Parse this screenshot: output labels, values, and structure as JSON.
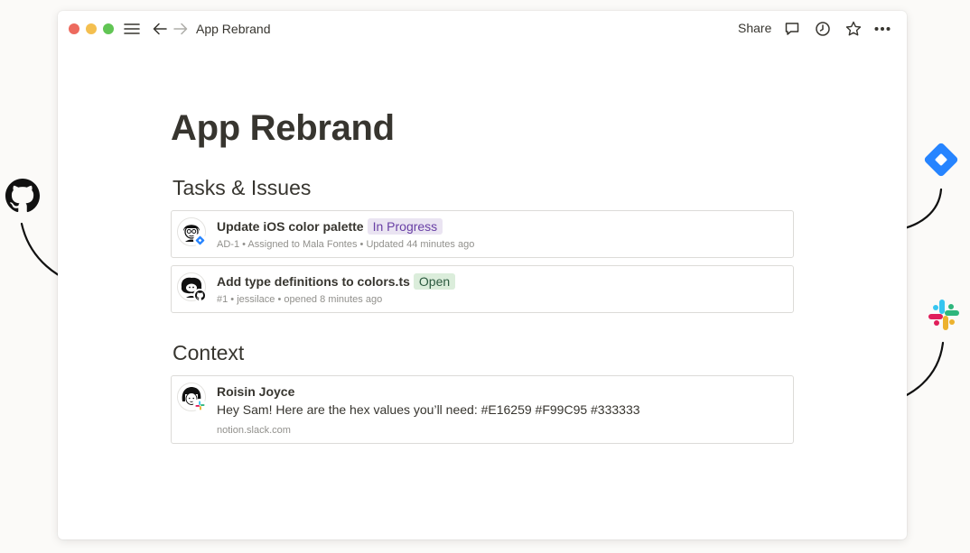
{
  "window": {
    "breadcrumb": "App Rebrand",
    "share_label": "Share",
    "traffic_lights": {
      "close": "#ed6a5e",
      "minimize": "#f4bf4f",
      "zoom": "#61c554"
    },
    "icons": [
      "menu-icon",
      "back-arrow-icon",
      "forward-arrow-icon",
      "comment-icon",
      "clock-history-icon",
      "star-icon",
      "more-icon"
    ]
  },
  "page": {
    "title": "App Rebrand",
    "sections": [
      {
        "heading": "Tasks & Issues",
        "items": [
          {
            "title": "Update iOS color palette",
            "status": "In Progress",
            "meta": "AD-1 • Assigned to Mala Fontes • Updated 44 minutes ago",
            "source_icon": "jira-icon"
          },
          {
            "title": "Add type definitions to colors.ts",
            "status": "Open",
            "meta": "#1 • jessilace • opened 8 minutes ago",
            "source_icon": "github-icon"
          }
        ]
      },
      {
        "heading": "Context",
        "items": [
          {
            "author": "Roisin Joyce",
            "text": "Hey Sam! Here are the hex values you’ll need: #E16259 #F99C95 #333333",
            "source": "notion.slack.com",
            "source_icon": "slack-icon"
          }
        ]
      }
    ]
  },
  "colors": {
    "in_progress_bg": "#eae4f2",
    "in_progress_text": "#6940a5",
    "open_bg": "#dbeddb",
    "open_text": "#2b593f",
    "jira_blue": "#2684ff"
  },
  "integrations": [
    "github-icon",
    "jira-icon",
    "slack-icon"
  ]
}
